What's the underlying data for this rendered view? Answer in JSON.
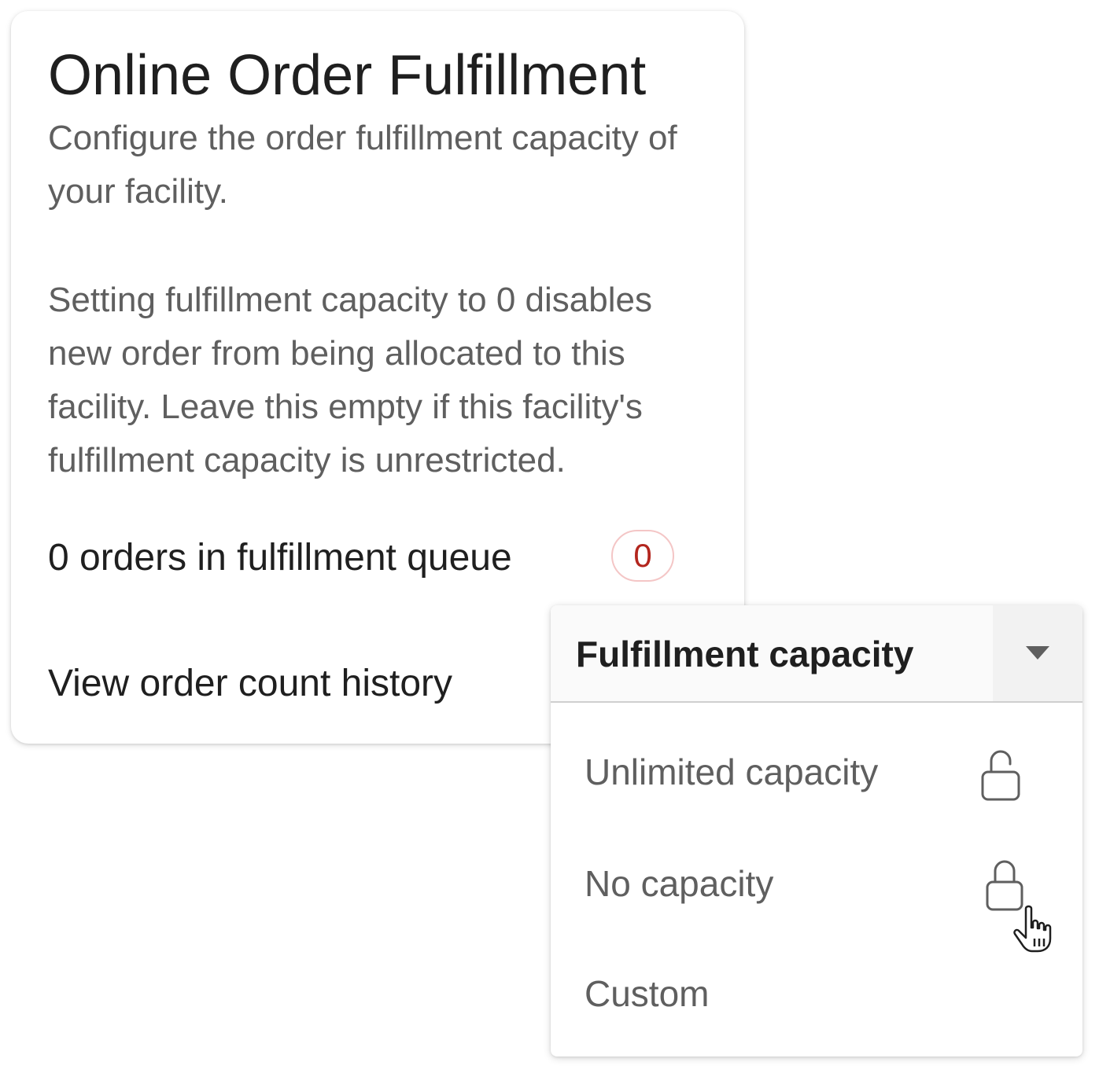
{
  "card": {
    "title": "Online Order Fulfillment",
    "subtitle": "Configure the order fulfillment capacity of your facility.",
    "description": "Setting fulfillment capacity to 0 disables new order from being allocated to this facility. Leave this empty if this facility's fulfillment capacity is unrestricted.",
    "queue_label": "0 orders in fulfillment queue",
    "queue_count": "0",
    "history_link": "View order count history"
  },
  "dropdown": {
    "selected_label": "Fulfillment capacity",
    "options": [
      {
        "label": "Unlimited capacity",
        "icon": "unlocked-icon"
      },
      {
        "label": "No capacity",
        "icon": "locked-icon"
      },
      {
        "label": "Custom",
        "icon": ""
      }
    ]
  },
  "colors": {
    "badge_text": "#b3261e",
    "badge_border": "#f4c6c6",
    "primary_text": "#1f1f1f",
    "secondary_text": "#5f5f5f"
  }
}
